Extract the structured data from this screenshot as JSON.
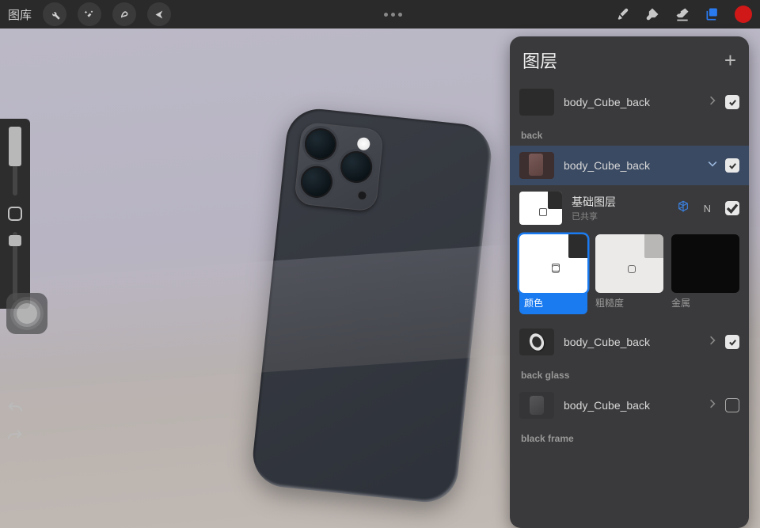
{
  "topbar": {
    "gallery_label": "图库",
    "tools": [
      "wrench-icon",
      "wand-icon",
      "shape-icon",
      "arrow-icon"
    ],
    "brush_icon": "brush-icon",
    "smudge_icon": "smudge-icon",
    "eraser_icon": "eraser-icon",
    "layers_icon": "layers-icon",
    "active_color": "#d01818"
  },
  "panel": {
    "title": "图层",
    "add": "+",
    "items": [
      {
        "label": "body_Cube_back",
        "checked": true,
        "expanded": false
      },
      {
        "section": "back"
      },
      {
        "label": "body_Cube_back",
        "checked": true,
        "selected": true,
        "expanded": true
      },
      {
        "base": {
          "title": "基础图层",
          "subtitle": "已共享",
          "link_icon": "cube-icon",
          "n": "N",
          "checked": true
        }
      },
      {
        "materials": [
          {
            "label": "颜色",
            "active": true
          },
          {
            "label": "粗糙度"
          },
          {
            "label": "金属"
          }
        ]
      },
      {
        "label": "body_Cube_back",
        "checked": true,
        "thumb": "ring"
      },
      {
        "section": "back glass"
      },
      {
        "label": "body_Cube_back",
        "checked": false,
        "thumb": "glass"
      },
      {
        "section": "black frame"
      }
    ]
  }
}
